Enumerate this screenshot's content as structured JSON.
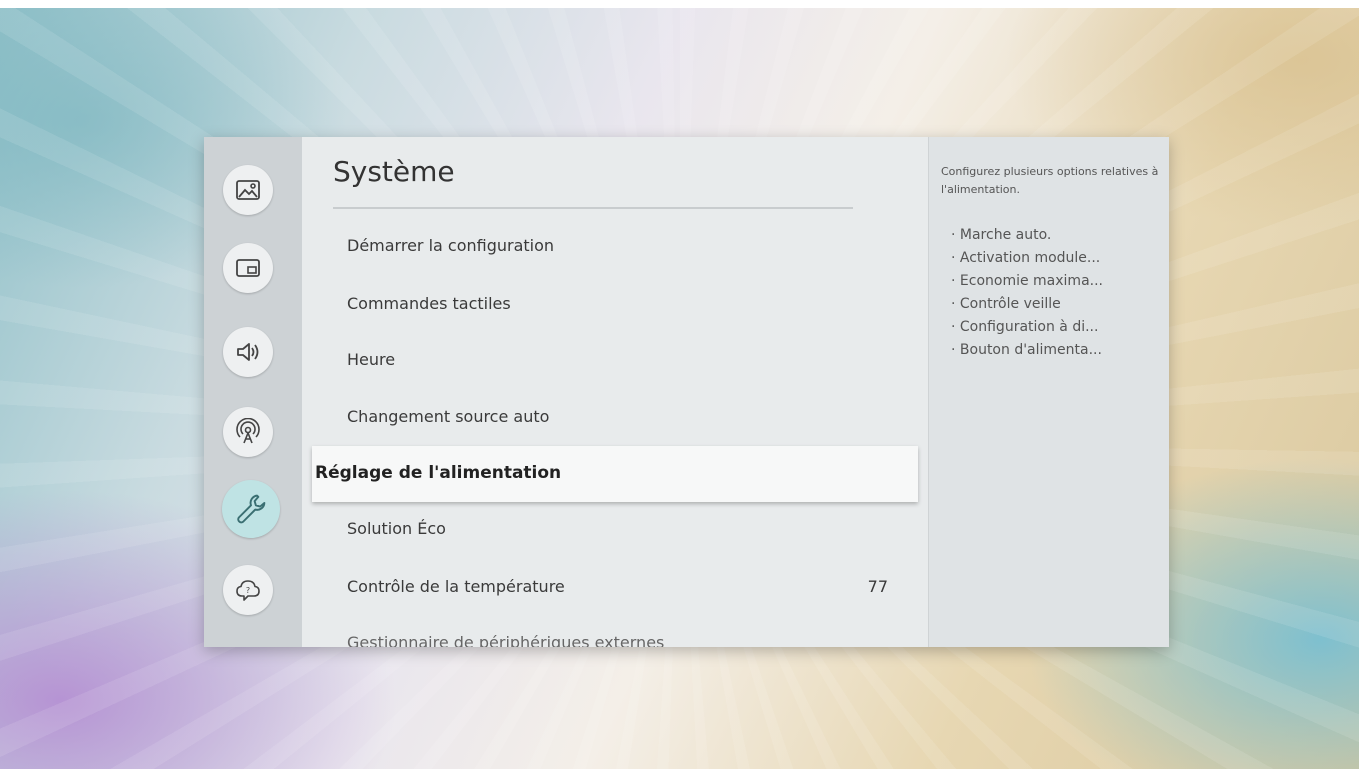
{
  "rail": {
    "items": [
      {
        "icon": "picture-icon"
      },
      {
        "icon": "picture-in-picture-icon"
      },
      {
        "icon": "sound-icon"
      },
      {
        "icon": "broadcast-icon"
      },
      {
        "icon": "wrench-icon",
        "active": true
      },
      {
        "icon": "support-icon"
      }
    ]
  },
  "main": {
    "title": "Système",
    "items": [
      {
        "label": "Démarrer la configuration",
        "value": ""
      },
      {
        "label": "Commandes tactiles",
        "value": ""
      },
      {
        "label": "Heure",
        "value": ""
      },
      {
        "label": "Changement source auto",
        "value": ""
      },
      {
        "label": "Réglage de l'alimentation",
        "value": "",
        "selected": true
      },
      {
        "label": "Solution Éco",
        "value": ""
      },
      {
        "label": "Contrôle de la température",
        "value": "77"
      },
      {
        "label": "Gestionnaire de périphériques externes",
        "value": ""
      }
    ]
  },
  "description": {
    "text": "Configurez plusieurs options relatives à l'alimentation.",
    "options": [
      "· Marche auto.",
      "· Activation module...",
      "· Economie maxima...",
      "· Contrôle veille",
      "· Configuration à di...",
      "· Bouton d'alimenta..."
    ]
  },
  "colors": {
    "accent": "#bfe3e4",
    "panel": "#e8ebec",
    "rail": "#cdd2d5"
  }
}
